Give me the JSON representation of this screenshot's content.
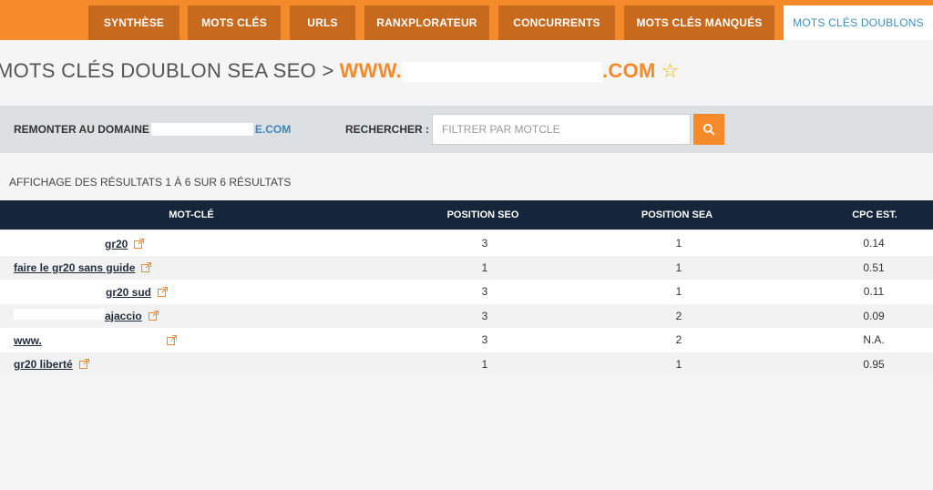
{
  "nav": {
    "tabs": [
      {
        "label": "SYNTHÈSE",
        "active": false
      },
      {
        "label": "MOTS CLÉS",
        "active": false
      },
      {
        "label": "URLS",
        "active": false
      },
      {
        "label": "RANXPLORATEUR",
        "active": false
      },
      {
        "label": "CONCURRENTS",
        "active": false
      },
      {
        "label": "MOTS CLÉS MANQUÉS",
        "active": false
      },
      {
        "label": "MOTS CLÉS DOUBLONS",
        "active": true
      }
    ]
  },
  "page": {
    "title": "MOTS CLÉS DOUBLON SEA SEO >",
    "domain_prefix": "WWW.",
    "domain_suffix": ".COM"
  },
  "filter": {
    "back_label": "REMONTER AU DOMAINE",
    "back_domain_suffix": "E.COM",
    "search_label": "RECHERCHER :",
    "search_placeholder": "FILTRER PAR MOTCLE"
  },
  "results": {
    "summary": "AFFICHAGE DES RÉSULTATS 1 À 6 SUR 6 RÉSULTATS"
  },
  "table": {
    "headers": [
      "MOT-CLÉ",
      "POSITION SEO",
      "POSITION SEA",
      "CPC EST."
    ],
    "rows": [
      {
        "keyword": "gr20",
        "seo": "3",
        "sea": "1",
        "cpc": "0.14"
      },
      {
        "keyword": "faire le gr20 sans guide",
        "seo": "1",
        "sea": "1",
        "cpc": "0.51"
      },
      {
        "keyword": "gr20 sud",
        "seo": "3",
        "sea": "1",
        "cpc": "0.11"
      },
      {
        "keyword": "ajaccio",
        "seo": "3",
        "sea": "2",
        "cpc": "0.09"
      },
      {
        "keyword": "www.",
        "seo": "3",
        "sea": "2",
        "cpc": "N.A."
      },
      {
        "keyword": "gr20 liberté",
        "seo": "1",
        "sea": "1",
        "cpc": "0.95"
      }
    ]
  },
  "colors": {
    "accent": "#f58a2a",
    "tab_dark": "#c86a1e",
    "header_navy": "#15263a",
    "link_blue": "#3a86b8"
  },
  "icons": {
    "search": "search-icon",
    "external": "external-link-icon",
    "favorite": "star-icon"
  }
}
